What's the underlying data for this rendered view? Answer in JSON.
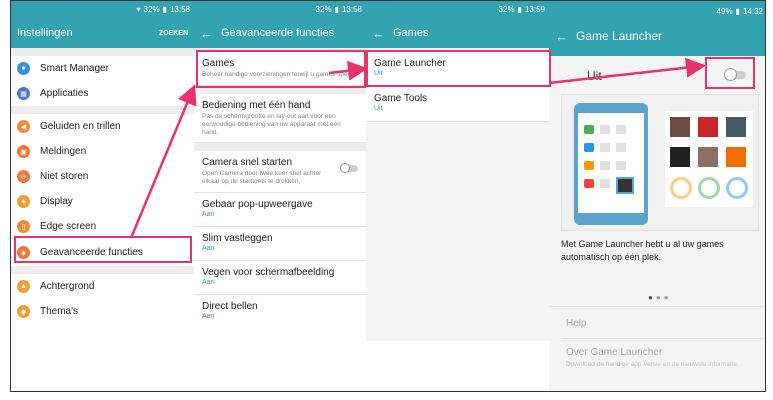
{
  "panel1": {
    "status_time": "13:58",
    "status_battery": "32%",
    "title": "Instellingen",
    "search_label": "ZOEKEN",
    "items": [
      {
        "label": "Smart Manager",
        "color": "#3a8fd8"
      },
      {
        "label": "Applicaties",
        "color": "#4a79c9"
      },
      {
        "label": "Geluiden en trillen",
        "color": "#f08c3a"
      },
      {
        "label": "Meldingen",
        "color": "#f0783a"
      },
      {
        "label": "Niet storen",
        "color": "#f0783a"
      },
      {
        "label": "Display",
        "color": "#f0a03a"
      },
      {
        "label": "Edge screen",
        "color": "#f08c3a"
      },
      {
        "label": "Geavanceerde functies",
        "color": "#f0783a"
      },
      {
        "label": "Achtergrond",
        "color": "#f0a03a"
      },
      {
        "label": "Thema's",
        "color": "#f0a03a"
      }
    ]
  },
  "panel2": {
    "status_time": "13:58",
    "status_battery": "32%",
    "title": "Geavanceerde functies",
    "items": [
      {
        "title": "Games",
        "sub": "Beheer handige voorzieningen terwijl u games speelt.",
        "value": ""
      },
      {
        "title": "Bediening met één hand",
        "sub": "Pas de schermgrootte en lay-out aan voor een eenvoudige bediening van uw apparaat met één hand.",
        "value": ""
      },
      {
        "title": "Camera snel starten",
        "sub": "Open Camera door twee keer snel achter elkaar op de starttoets te drukken.",
        "value": ""
      },
      {
        "title": "Gebaar pop-upweergave",
        "sub": "",
        "value": "Aan"
      },
      {
        "title": "Slim vastleggen",
        "sub": "",
        "value": "Aan"
      },
      {
        "title": "Vegen voor schermafbeelding",
        "sub": "",
        "value": "Aan"
      },
      {
        "title": "Direct bellen",
        "sub": "",
        "value": "Aan"
      }
    ]
  },
  "panel3": {
    "status_time": "13:59",
    "status_battery": "32%",
    "title": "Games",
    "items": [
      {
        "title": "Game Launcher",
        "value": "Uit"
      },
      {
        "title": "Game Tools",
        "value": "Uit"
      }
    ]
  },
  "panel4": {
    "status_time": "14:32",
    "status_battery": "49%",
    "title": "Game Launcher",
    "toggle_label": "Uit",
    "description": "Met Game Launcher hebt u al uw games automatisch op één plek.",
    "help": "Help",
    "about": "Over Game Launcher",
    "about_sub": "Download de handige app-versie en de nieuwste informatie."
  },
  "colors": {
    "accent": "#34a3b1",
    "highlight": "#e8336b",
    "link": "#3a8fd8"
  }
}
